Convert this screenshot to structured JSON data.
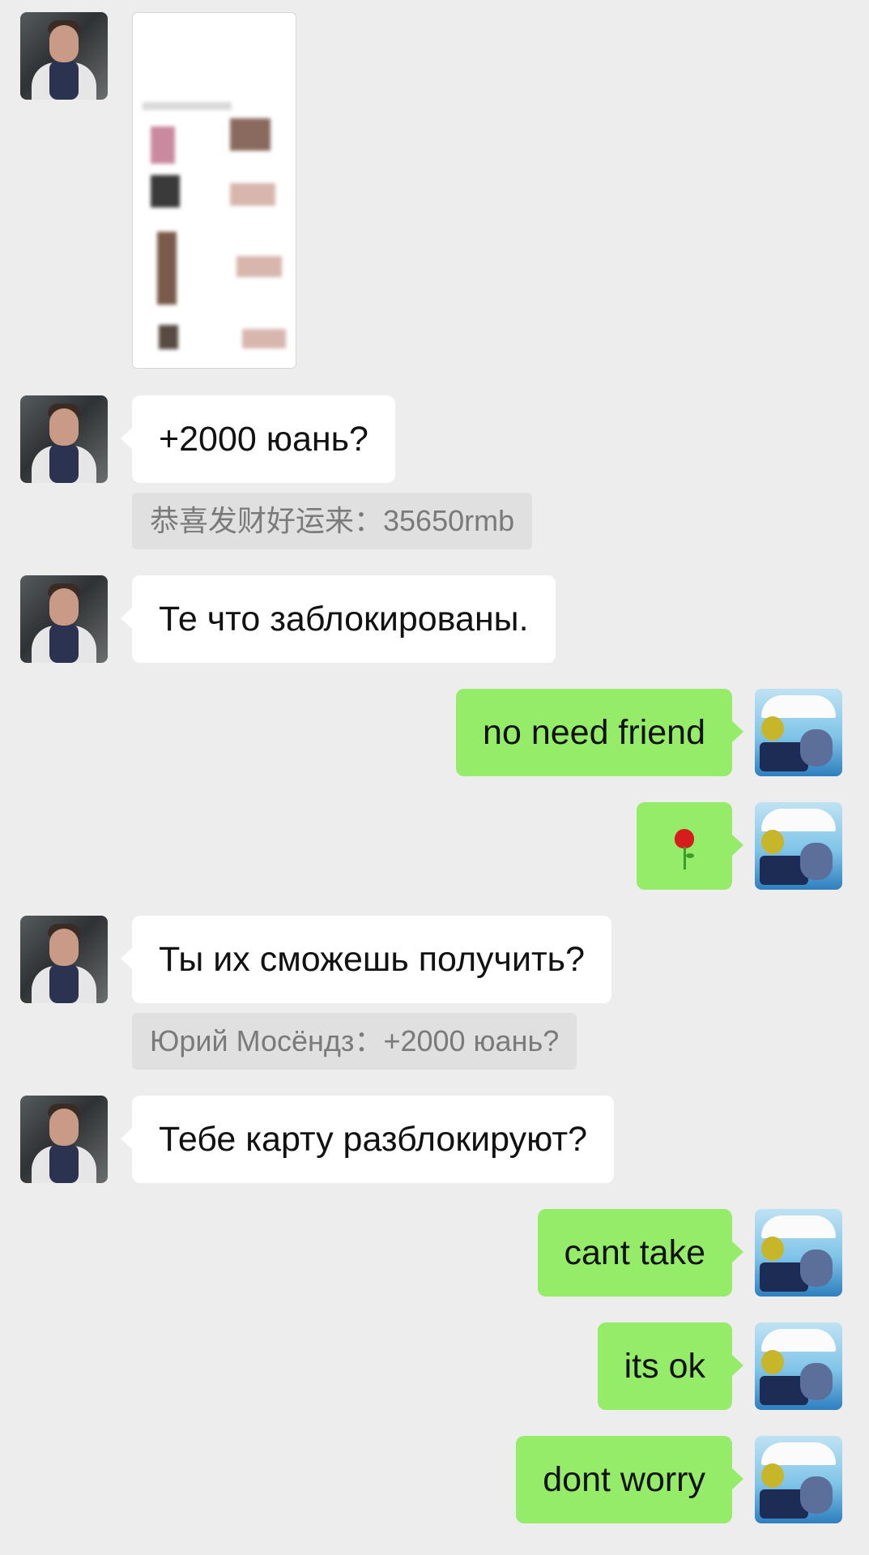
{
  "messages": [
    {
      "side": "in",
      "type": "image",
      "sender": "friend"
    },
    {
      "side": "in",
      "type": "text",
      "text": "+2000 юань?",
      "quote": "恭喜发财好运来：35650rmb"
    },
    {
      "side": "in",
      "type": "text",
      "text": "Те что заблокированы."
    },
    {
      "side": "out",
      "type": "text",
      "text": "no need friend"
    },
    {
      "side": "out",
      "type": "emoji",
      "icon": "rose-icon"
    },
    {
      "side": "in",
      "type": "text",
      "text": "Ты их сможешь получить?",
      "quote": "Юрий Мосёндз：+2000 юань?"
    },
    {
      "side": "in",
      "type": "text",
      "text": "Тебе карту разблокируют?"
    },
    {
      "side": "out",
      "type": "text",
      "text": "cant take"
    },
    {
      "side": "out",
      "type": "text",
      "text": "its ok"
    },
    {
      "side": "out",
      "type": "text",
      "text": "dont worry"
    }
  ],
  "colors": {
    "background": "#ededed",
    "incoming_bubble": "#ffffff",
    "outgoing_bubble": "#95ec69",
    "quote_background": "#e0e0e0",
    "quote_text": "#7a7a7a"
  },
  "avatars": {
    "friend": "friend-avatar",
    "me": "my-avatar"
  }
}
